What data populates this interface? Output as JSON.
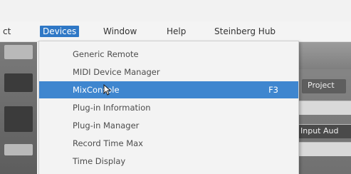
{
  "menubar": {
    "items": [
      {
        "label": "ct"
      },
      {
        "label": "Devices"
      },
      {
        "label": "Window"
      },
      {
        "label": "Help"
      },
      {
        "label": "Steinberg Hub"
      }
    ]
  },
  "dropdown": {
    "items": [
      {
        "label": "Generic Remote",
        "shortcut": ""
      },
      {
        "label": "MIDI Device Manager",
        "shortcut": ""
      },
      {
        "label": "MixConsole",
        "shortcut": "F3"
      },
      {
        "label": "Plug-in Information",
        "shortcut": ""
      },
      {
        "label": "Plug-in Manager",
        "shortcut": ""
      },
      {
        "label": "Record Time Max",
        "shortcut": ""
      },
      {
        "label": "Time Display",
        "shortcut": ""
      }
    ],
    "highlighted_index": 2
  },
  "right_panel": {
    "label_1": "Project",
    "label_2": "Input Aud"
  },
  "colors": {
    "menu_active": "#2f78c6",
    "item_highlight": "#3f86cf",
    "menu_bg": "#f3f3f3"
  },
  "icons": {
    "cursor": "pointer-cursor-icon"
  }
}
